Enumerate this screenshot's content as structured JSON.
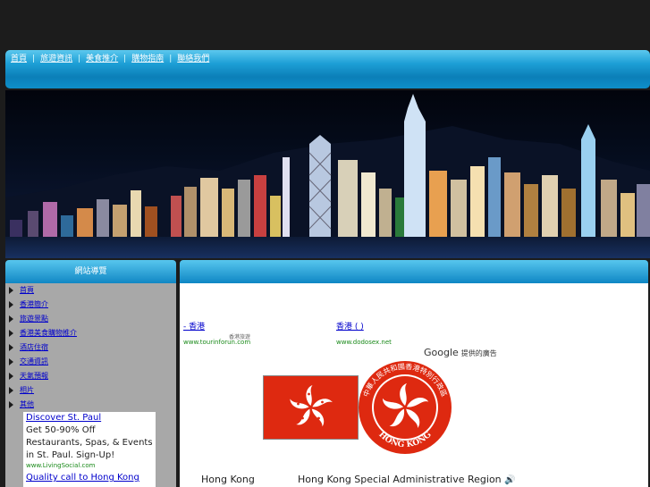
{
  "nav": {
    "items": [
      "首頁",
      "旅遊資訊",
      "美食推介",
      "購物指南",
      "聯絡我們"
    ]
  },
  "sidebar": {
    "title": "網站導覽",
    "items": [
      "首頁",
      "香港簡介",
      "旅遊景點",
      "香港美食購物推介",
      "酒店住宿",
      "交通資訊",
      "天氣預報",
      "相片",
      "其他"
    ]
  },
  "ads": {
    "left": [
      {
        "title": "Discover St. Paul",
        "body": "Get 50-90% Off Restaurants, Spas, & Events in St. Paul. Sign-Up!",
        "url": "www.LivingSocial.com"
      },
      {
        "title": "Quality call to Hong Kong"
      }
    ],
    "main": [
      {
        "title": "- 香港",
        "desc": "香港旅遊",
        "url": "www.tourinforun.com"
      },
      {
        "title": "香港 ( )",
        "url": "www.dodosex.net"
      }
    ],
    "google_label": "Google",
    "provided_by": "提供的廣告"
  },
  "content": {
    "caption_left": "Hong Kong",
    "caption_right": "Hong Kong Special Administrative Region",
    "emblem_top_text": "中華人民共和國香港特別行政區",
    "emblem_bottom_text": "HONG KONG"
  },
  "colors": {
    "accent": "#1d9fd6",
    "flag_red": "#de2910",
    "link": "#0000cc",
    "url_green": "#1a8a1a"
  }
}
